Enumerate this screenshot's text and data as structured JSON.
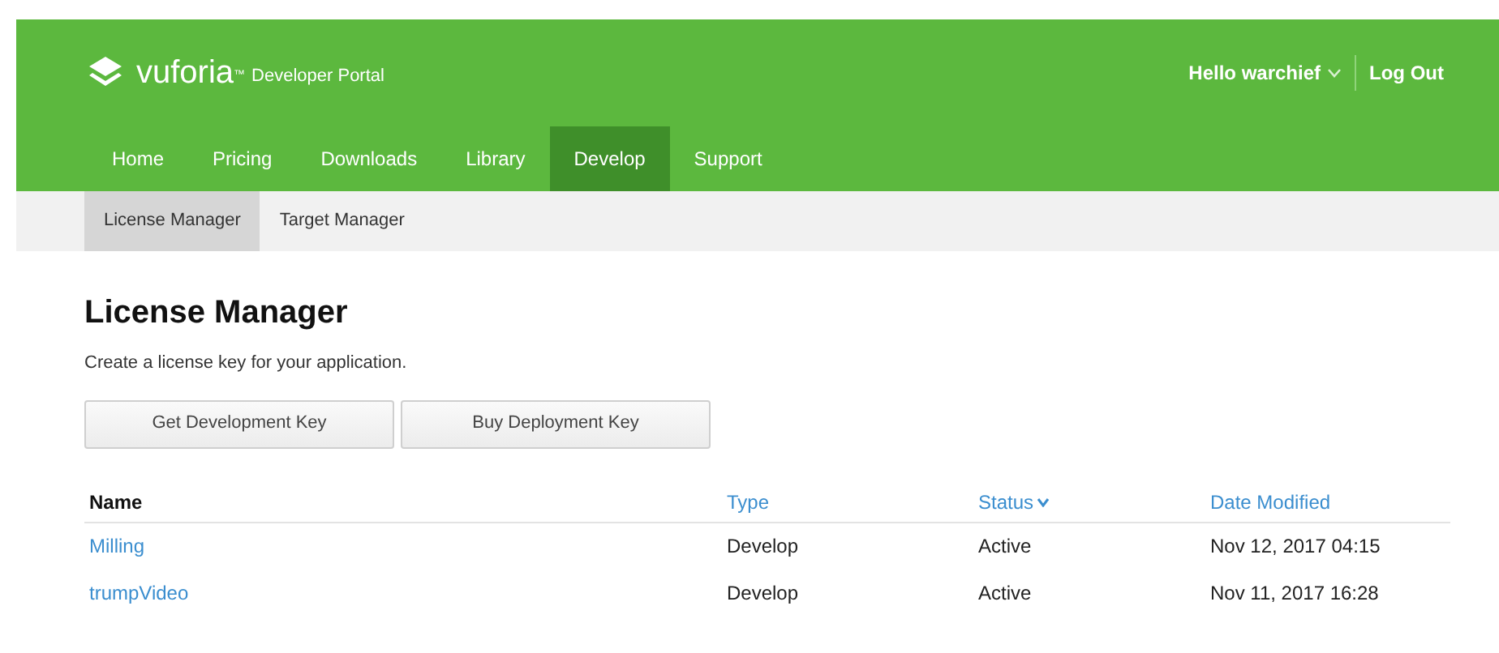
{
  "header": {
    "logo": "vuforia",
    "logo_mark": "™",
    "portal": "Developer Portal",
    "greeting": "Hello warchief",
    "logout": "Log Out"
  },
  "nav": [
    {
      "label": "Home",
      "selected": false
    },
    {
      "label": "Pricing",
      "selected": false
    },
    {
      "label": "Downloads",
      "selected": false
    },
    {
      "label": "Library",
      "selected": false
    },
    {
      "label": "Develop",
      "selected": true
    },
    {
      "label": "Support",
      "selected": false
    }
  ],
  "subnav": [
    {
      "label": "License Manager",
      "selected": true
    },
    {
      "label": "Target Manager",
      "selected": false
    }
  ],
  "page": {
    "title": "License Manager",
    "subtitle": "Create a license key for your application.",
    "buttons": [
      "Get Development Key",
      "Buy Deployment Key"
    ]
  },
  "table": {
    "columns": [
      {
        "label": "Name",
        "sortable": false,
        "sorted": false
      },
      {
        "label": "Type",
        "sortable": true,
        "sorted": false
      },
      {
        "label": "Status",
        "sortable": true,
        "sorted": true
      },
      {
        "label": "Date Modified",
        "sortable": true,
        "sorted": false
      }
    ],
    "rows": [
      [
        "Milling",
        "Develop",
        "Active",
        "Nov 12, 2017 04:15"
      ],
      [
        "trumpVideo",
        "Develop",
        "Active",
        "Nov 11, 2017 16:28"
      ]
    ]
  }
}
